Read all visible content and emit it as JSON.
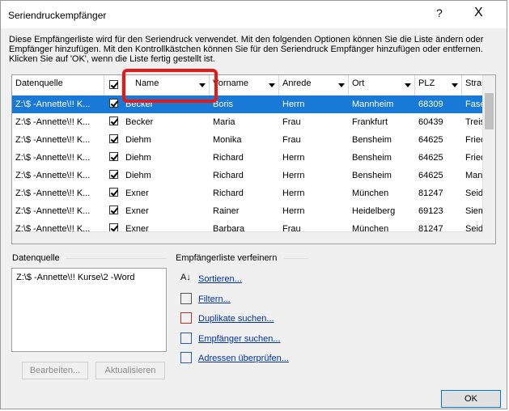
{
  "dialog": {
    "title": "Seriendruckempfänger",
    "help_label": "?",
    "close_label": "X",
    "description": "Diese Empfängerliste wird für den Seriendruck verwendet. Mit den folgenden Optionen können Sie die Liste ändern oder Empfänger hinzufügen. Mit den Kontrollkästchen können Sie für den Seriendruck Empfänger hinzufügen oder entfernen. Klicken Sie auf 'OK', wenn die Liste fertig gestellt ist."
  },
  "table": {
    "columns": [
      "Datenquelle",
      "",
      "Name",
      "Vorname",
      "Anrede",
      "Ort",
      "PLZ",
      "Straße"
    ],
    "rows": [
      {
        "source": "Z:\\$ -Annette\\!! K...",
        "checked": true,
        "name": "Becker",
        "vorname": "Boris",
        "anrede": "Herrn",
        "ort": "Mannheim",
        "plz": "68309",
        "strasse": "Fasen",
        "selected": true
      },
      {
        "source": "Z:\\$ -Annette\\!! K...",
        "checked": true,
        "name": "Becker",
        "vorname": "Maria",
        "anrede": "Frau",
        "ort": "Frankfurt",
        "plz": "60439",
        "strasse": "Treisb"
      },
      {
        "source": "Z:\\$ -Annette\\!! K...",
        "checked": true,
        "name": "Diehm",
        "vorname": "Monika",
        "anrede": "Frau",
        "ort": "Bensheim",
        "plz": "64625",
        "strasse": "Fried"
      },
      {
        "source": "Z:\\$ -Annette\\!! K...",
        "checked": true,
        "name": "Diehm",
        "vorname": "Richard",
        "anrede": "Herrn",
        "ort": "Bensheim",
        "plz": "64625",
        "strasse": "Fried"
      },
      {
        "source": "Z:\\$ -Annette\\!! K...",
        "checked": true,
        "name": "Diehm",
        "vorname": "Richard",
        "anrede": "Herrn",
        "ort": "Bensheim",
        "plz": "64625",
        "strasse": "Mann"
      },
      {
        "source": "Z:\\$ -Annette\\!! K...",
        "checked": true,
        "name": "Exner",
        "vorname": "Richard",
        "anrede": "Herrn",
        "ort": "München",
        "plz": "81247",
        "strasse": "Seidv"
      },
      {
        "source": "Z:\\$ -Annette\\!! K...",
        "checked": true,
        "name": "Exner",
        "vorname": "Rainer",
        "anrede": "Herrn",
        "ort": "Heidelberg",
        "plz": "69123",
        "strasse": "Siem"
      },
      {
        "source": "Z:\\$ -Annette\\!! K...",
        "checked": true,
        "name": "Exner",
        "vorname": "Barbara",
        "anrede": "Frau",
        "ort": "München",
        "plz": "81247",
        "strasse": "Seidv"
      }
    ]
  },
  "datasource": {
    "title": "Datenquelle",
    "item": "Z:\\$ -Annette\\!! Kurse\\2 -Word",
    "edit_button": "Bearbeiten...",
    "refresh_button": "Aktualisieren"
  },
  "refine": {
    "title": "Empfängerliste verfeinern",
    "sort": "Sortieren...",
    "filter": "Filtern...",
    "duplicates": "Duplikate suchen...",
    "find": "Empfänger suchen...",
    "validate": "Adressen überprüfen..."
  },
  "ok_button": "OK",
  "colors": {
    "selection": "#1879d6",
    "highlight": "#e81818",
    "link": "#0033aa"
  }
}
